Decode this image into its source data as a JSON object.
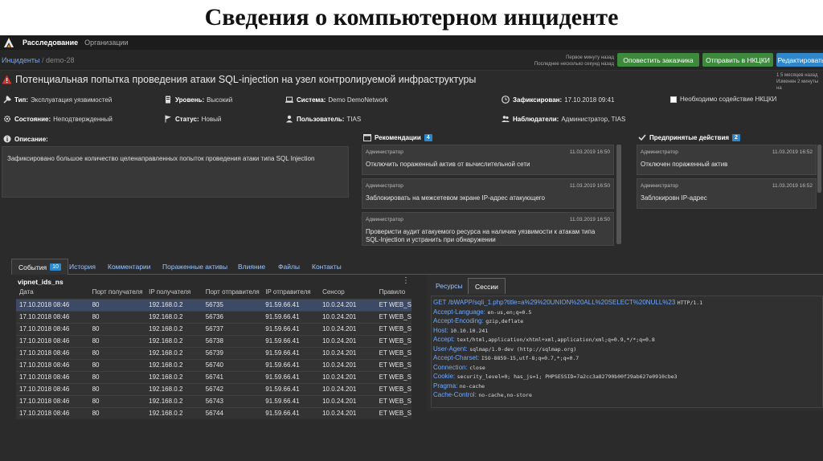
{
  "slide": {
    "title": "Сведения о компьютерном инциденте"
  },
  "topbar": {
    "nav_active": "Расследование",
    "nav_other": "Организации"
  },
  "breadcrumb": {
    "root": "Инциденты",
    "sep": "/",
    "current": "demo-28"
  },
  "updates": {
    "line1": "Первое минуту назад",
    "line2": "Последнее несколько секунд назад"
  },
  "actions": {
    "notify_customer": "Оповестить заказчика",
    "send_nkcki": "Отправить в НКЦКИ",
    "edit": "Редактировать"
  },
  "right_note": {
    "line1": "1 5 месяцев назад",
    "line2": "Изменен 2 минуты на"
  },
  "incident": {
    "title": "Потенциальная попытка проведения атаки SQL-injection на узел контролируемой инфраструктуры",
    "type_label": "Тип:",
    "type_value": "Эксплуатация уязвимостей",
    "level_label": "Уровень:",
    "level_value": "Высокий",
    "system_label": "Система:",
    "system_value": "Demo DemoNetwork",
    "registered_label": "Зафиксирован:",
    "registered_value": "17.10.2018 09:41",
    "nkcki_checkbox": "Необходимо содействие НКЦКИ",
    "state_label": "Состояние:",
    "state_value": "Неподтвержденный",
    "status_label": "Статус:",
    "status_value": "Новый",
    "user_label": "Пользователь:",
    "user_value": "TIAS",
    "observers_label": "Наблюдатели:",
    "observers_value": "Администратор, TIAS"
  },
  "description": {
    "title": "Описание:",
    "text": "Зафиксировано большое количество целенаправленных попыток проведения атаки типа SQL Injection"
  },
  "recommendations": {
    "title": "Рекомендации",
    "count": "4",
    "items": [
      {
        "author": "Администратор",
        "time": "11.03.2019 16:50",
        "text": "Отключить пораженный актив от вычислительной сети"
      },
      {
        "author": "Администратор",
        "time": "11.03.2019 16:50",
        "text": "Заблокировать на межсетевом экране IP-адрес атакующего"
      },
      {
        "author": "Администратор",
        "time": "11.03.2019 16:50",
        "text": "Проверисти аудит атакуемого ресурса на наличие уязвимости к атакам типа SQL-Injection и устранить при обнаружении"
      }
    ]
  },
  "actions_taken": {
    "title": "Предпринятые действия",
    "count": "2",
    "items": [
      {
        "author": "Администратор",
        "time": "11.03.2019 16:52",
        "text": "Отключен пораженный актив"
      },
      {
        "author": "Администратор",
        "time": "11.03.2019 16:52",
        "text": "Заблокировн IP-адрес"
      }
    ]
  },
  "tabs": [
    {
      "label": "События",
      "badge": "10"
    },
    {
      "label": "История"
    },
    {
      "label": "Комментарии"
    },
    {
      "label": "Пораженные активы"
    },
    {
      "label": "Влияние"
    },
    {
      "label": "Файлы"
    },
    {
      "label": "Контакты"
    }
  ],
  "events": {
    "source": "vipnet_ids_ns",
    "columns": [
      "Дата",
      "Порт получателя",
      "IP получателя",
      "Порт отправителя",
      "IP отправителя",
      "Сенсор",
      "Правило"
    ],
    "rows": [
      [
        "17.10.2018 08:46",
        "80",
        "192.168.0.2",
        "56735",
        "91.59.66.41",
        "10.0.24.201",
        "ET WEB_S"
      ],
      [
        "17.10.2018 08:46",
        "80",
        "192.168.0.2",
        "56736",
        "91.59.66.41",
        "10.0.24.201",
        "ET WEB_S"
      ],
      [
        "17.10.2018 08:46",
        "80",
        "192.168.0.2",
        "56737",
        "91.59.66.41",
        "10.0.24.201",
        "ET WEB_S"
      ],
      [
        "17.10.2018 08:46",
        "80",
        "192.168.0.2",
        "56738",
        "91.59.66.41",
        "10.0.24.201",
        "ET WEB_S"
      ],
      [
        "17.10.2018 08:46",
        "80",
        "192.168.0.2",
        "56739",
        "91.59.66.41",
        "10.0.24.201",
        "ET WEB_S"
      ],
      [
        "17.10.2018 08:46",
        "80",
        "192.168.0.2",
        "56740",
        "91.59.66.41",
        "10.0.24.201",
        "ET WEB_S"
      ],
      [
        "17.10.2018 08:46",
        "80",
        "192.168.0.2",
        "56741",
        "91.59.66.41",
        "10.0.24.201",
        "ET WEB_S"
      ],
      [
        "17.10.2018 08:46",
        "80",
        "192.168.0.2",
        "56742",
        "91.59.66.41",
        "10.0.24.201",
        "ET WEB_S"
      ],
      [
        "17.10.2018 08:46",
        "80",
        "192.168.0.2",
        "56743",
        "91.59.66.41",
        "10.0.24.201",
        "ET WEB_S"
      ],
      [
        "17.10.2018 08:46",
        "80",
        "192.168.0.2",
        "56744",
        "91.59.66.41",
        "10.0.24.201",
        "ET WEB_S"
      ]
    ]
  },
  "detail_tabs": {
    "resources": "Ресурсы",
    "sessions": "Сессии"
  },
  "http": {
    "method": "GET",
    "path": "/bWAPP/sqli_1.php?title=a%29%20UNION%20ALL%20SELECT%20NULL%23",
    "proto": "HTTP/1.1",
    "headers": [
      {
        "k": "Accept-Language:",
        "v": "en-us,en;q=0.5"
      },
      {
        "k": "Accept-Encoding:",
        "v": "gzip,deflate"
      },
      {
        "k": "Host:",
        "v": "10.10.10.241"
      },
      {
        "k": "Accept:",
        "v": "text/html,application/xhtml+xml,application/xml;q=0.9,*/*;q=0.8"
      },
      {
        "k": "User-Agent:",
        "v": "sqlmap/1.0-dev (http://sqlmap.org)"
      },
      {
        "k": "Accept-Charset:",
        "v": "ISO-8859-15,utf-8;q=0.7,*;q=0.7"
      },
      {
        "k": "Connection:",
        "v": "close"
      },
      {
        "k": "Cookie:",
        "v": "security_level=0; has_js=1; PHPSESSID=7a2cc3a82790b00f29ab627e0910cbe3"
      },
      {
        "k": "Pragma:",
        "v": "no-cache"
      },
      {
        "k": "Cache-Control:",
        "v": "no-cache,no-store"
      }
    ]
  },
  "colors": {
    "accent_blue": "#2f86c9",
    "accent_green": "#3d8a3d",
    "warning_red": "#d9342b"
  }
}
